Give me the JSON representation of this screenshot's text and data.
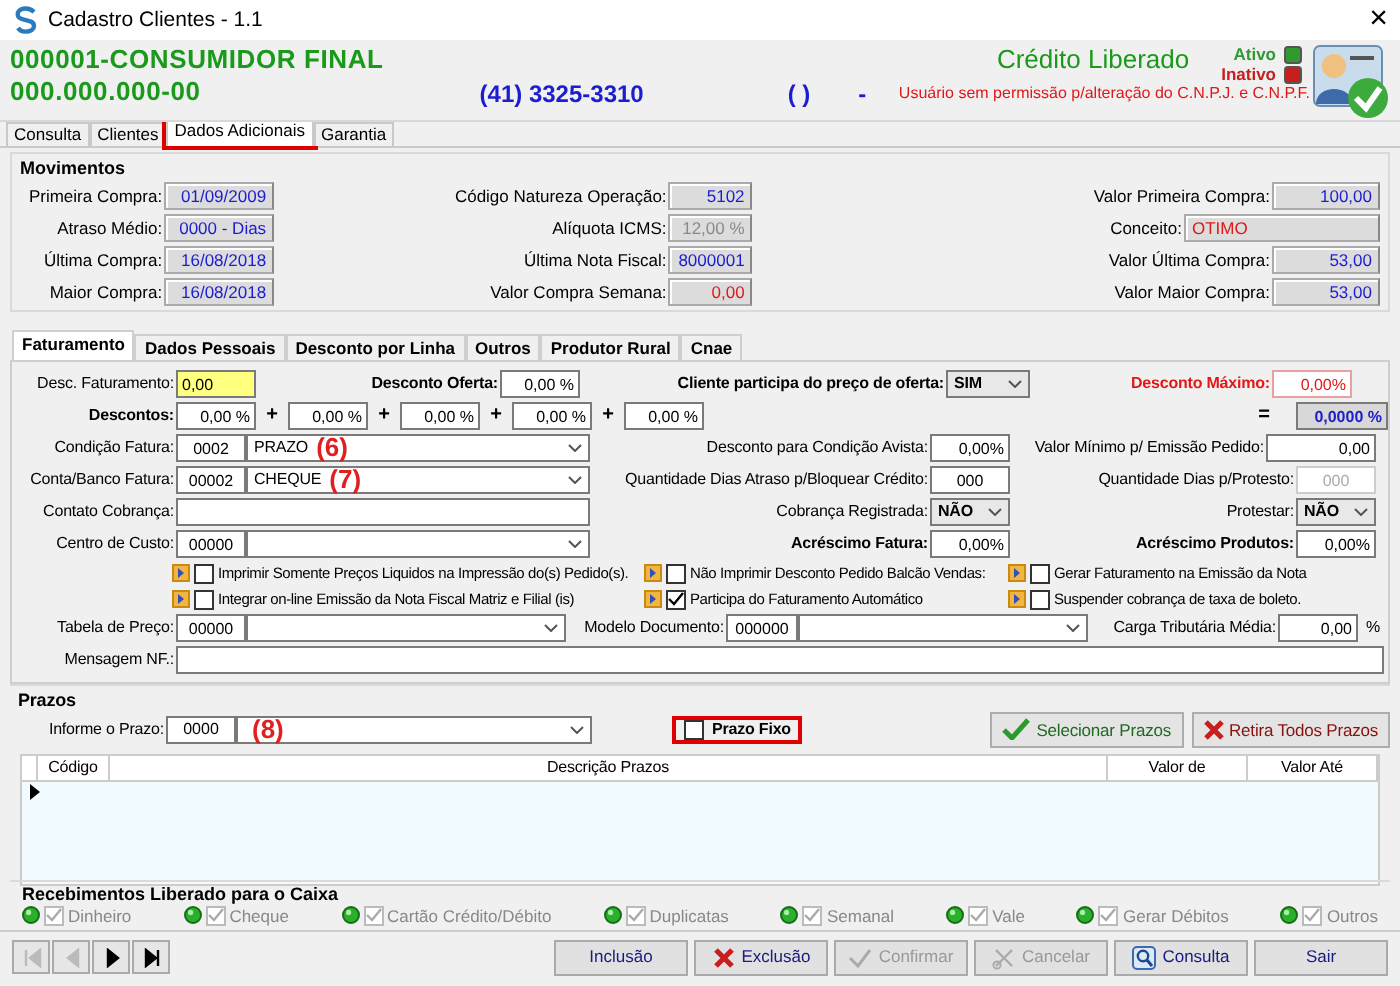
{
  "window": {
    "title": "Cadastro Clientes - 1.1",
    "close": "×"
  },
  "header": {
    "name": "000001-CONSUMIDOR FINAL",
    "document": "000.000.000-00",
    "phone": "(41) 3325-3310",
    "phone2": "(    )",
    "separator": "-",
    "credit_status": "Crédito Liberado",
    "legend": [
      {
        "label": "Ativo",
        "color": "#2f9a2f"
      },
      {
        "label": "Inativo",
        "color": "#c81e1e"
      }
    ],
    "warning": "Usuário sem permissão p/alteração do C.N.P.J.  e C.N.P.F."
  },
  "tabs": [
    {
      "label": "Consulta",
      "selected": false,
      "highlighted": false
    },
    {
      "label": "Clientes",
      "selected": false,
      "highlighted": false
    },
    {
      "label": "Dados Adicionais",
      "selected": true,
      "highlighted": true
    },
    {
      "label": "Garantia",
      "selected": false,
      "highlighted": false
    }
  ],
  "movimentos": {
    "title": "Movimentos",
    "columns": [
      [
        {
          "label": "Primeira Compra:",
          "value": "01/09/2009",
          "alert": false,
          "disabled": false
        },
        {
          "label": "Atraso Médio:",
          "value": "0000 - Dias",
          "alert": false,
          "disabled": false
        },
        {
          "label": "Última Compra:",
          "value": "16/08/2018",
          "alert": false,
          "disabled": false
        },
        {
          "label": "Maior Compra:",
          "value": "16/08/2018",
          "alert": false,
          "disabled": false
        }
      ],
      [
        {
          "label": "Código Natureza Operação:",
          "value": "5102",
          "alert": false,
          "disabled": false
        },
        {
          "label": "Alíquota ICMS:",
          "value": "12,00 %",
          "alert": false,
          "disabled": true
        },
        {
          "label": "Última Nota Fiscal:",
          "value": "8000001",
          "alert": false,
          "disabled": false
        },
        {
          "label": "Valor Compra Semana:",
          "value": "0,00",
          "alert": true,
          "disabled": false
        }
      ],
      [
        {
          "label": "Valor Primeira Compra:",
          "value": "100,00",
          "alert": false,
          "disabled": false
        },
        {
          "label": "Conceito:",
          "value": "OTIMO",
          "alert": true,
          "disabled": false
        },
        {
          "label": "Valor Última Compra:",
          "value": "53,00",
          "alert": false,
          "disabled": false
        },
        {
          "label": "Valor Maior Compra:",
          "value": "53,00",
          "alert": false,
          "disabled": false
        }
      ]
    ]
  },
  "inner_tabs": [
    {
      "label": "Faturamento",
      "selected": true
    },
    {
      "label": "Dados Pessoais",
      "selected": false
    },
    {
      "label": "Desconto por Linha",
      "selected": false
    },
    {
      "label": "Outros",
      "selected": false
    },
    {
      "label": "Produtor Rural",
      "selected": false
    },
    {
      "label": "Cnae",
      "selected": false
    }
  ],
  "faturamento": {
    "desc_faturamento": {
      "label": "Desc. Faturamento:",
      "value": "0,00"
    },
    "desconto_oferta": {
      "label": "Desconto Oferta:",
      "value": "0,00 %"
    },
    "participa_oferta": {
      "label": "Cliente participa do preço de oferta:",
      "value": "SIM"
    },
    "desconto_maximo": {
      "label": "Desconto Máximo:",
      "value": "0,00%"
    },
    "descontos": {
      "label": "Descontos:",
      "values": [
        "0,00 %",
        "0,00 %",
        "0,00 %",
        "0,00 %",
        "0,00 %"
      ],
      "operators": [
        "+",
        "+",
        "+",
        "+"
      ],
      "equals": "=",
      "total": "0,0000 %"
    },
    "condicao_fatura": {
      "label": "Condição Fatura:",
      "code": "0002",
      "value": "PRAZO",
      "annotation": "(6)"
    },
    "conta_banco": {
      "label": "Conta/Banco Fatura:",
      "code": "00002",
      "value": "CHEQUE",
      "annotation": "(7)"
    },
    "contato_cobranca": {
      "label": "Contato Cobrança:"
    },
    "centro_custo": {
      "label": "Centro de Custo:",
      "code": "00000"
    },
    "desconto_avista": {
      "label": "Desconto para Condição Avista:",
      "value": "0,00%"
    },
    "valor_minimo": {
      "label": "Valor Mínimo p/ Emissão Pedido:",
      "value": "0,00"
    },
    "dias_atraso": {
      "label": "Quantidade Dias Atraso  p/Bloquear Crédito:",
      "value": "000"
    },
    "dias_protesto": {
      "label": "Quantidade Dias p/Protesto:",
      "value": "000",
      "disabled": true
    },
    "cobranca_registrada": {
      "label": "Cobrança Registrada:",
      "value": "NÃO"
    },
    "protestar": {
      "label": "Protestar:",
      "value": "NÃO"
    },
    "acrescimo_fatura": {
      "label": "Acréscimo Fatura:",
      "value": "0,00%"
    },
    "acrescimo_produtos": {
      "label": "Acréscimo Produtos:",
      "value": "0,00%"
    },
    "options": [
      {
        "label": "Imprimir Somente Preços Liquidos na Impressão do(s) Pedido(s).",
        "checked": false
      },
      {
        "label": "Não Imprimir Desconto Pedido  Balcão Vendas:",
        "checked": false
      },
      {
        "label": "Gerar Faturamento na Emissão da Nota",
        "checked": false
      },
      {
        "label": "Integrar on-line Emissão da Nota Fiscal Matriz e Filial (is)",
        "checked": false
      },
      {
        "label": "Participa do Faturamento Automático",
        "checked": true
      },
      {
        "label": "Suspender cobrança de taxa de boleto.",
        "checked": false
      }
    ],
    "tabela_preco": {
      "label": "Tabela de Preço:",
      "code": "00000"
    },
    "modelo_documento": {
      "label": "Modelo Documento:",
      "code": "000000"
    },
    "carga_tributaria": {
      "label": "Carga Tributária Média:",
      "value": "0,00",
      "unit": "%"
    },
    "mensagem_nf": {
      "label": "Mensagem NF.:"
    }
  },
  "prazos": {
    "title": "Prazos",
    "informe": {
      "label": "Informe o Prazo:",
      "code": "0000",
      "annotation": "(8)"
    },
    "prazo_fixo": {
      "label": "Prazo Fixo",
      "checked": false,
      "highlighted": true
    },
    "buttons": [
      "Selecionar Prazos",
      "Retira Todos Prazos"
    ],
    "table": {
      "columns": [
        "Código",
        "Descrição Prazos",
        "Valor de",
        "Valor Até"
      ]
    }
  },
  "recebimentos": {
    "title": "Recebimentos Liberado para o Caixa",
    "items": [
      {
        "label": "Dinheiro",
        "checked": true,
        "disabled": true
      },
      {
        "label": "Cheque",
        "checked": true,
        "disabled": true
      },
      {
        "label": "Cartão Crédito/Débito",
        "checked": true,
        "disabled": true
      },
      {
        "label": "Duplicatas",
        "checked": true,
        "disabled": true
      },
      {
        "label": "Semanal",
        "checked": true,
        "disabled": true
      },
      {
        "label": "Vale",
        "checked": true,
        "disabled": true
      },
      {
        "label": "Gerar Débitos",
        "checked": true,
        "disabled": true
      },
      {
        "label": "Outros",
        "checked": true,
        "disabled": true
      }
    ]
  },
  "navigator": [
    {
      "disabled": true
    },
    {
      "disabled": true
    },
    {
      "disabled": false
    },
    {
      "disabled": false
    }
  ],
  "actions": [
    {
      "label": "Inclusão",
      "disabled": false
    },
    {
      "label": "Exclusão",
      "disabled": false
    },
    {
      "label": "Confirmar",
      "disabled": true
    },
    {
      "label": "Cancelar",
      "disabled": true
    },
    {
      "label": "Consulta",
      "disabled": false
    },
    {
      "label": "Sair",
      "disabled": false
    }
  ]
}
